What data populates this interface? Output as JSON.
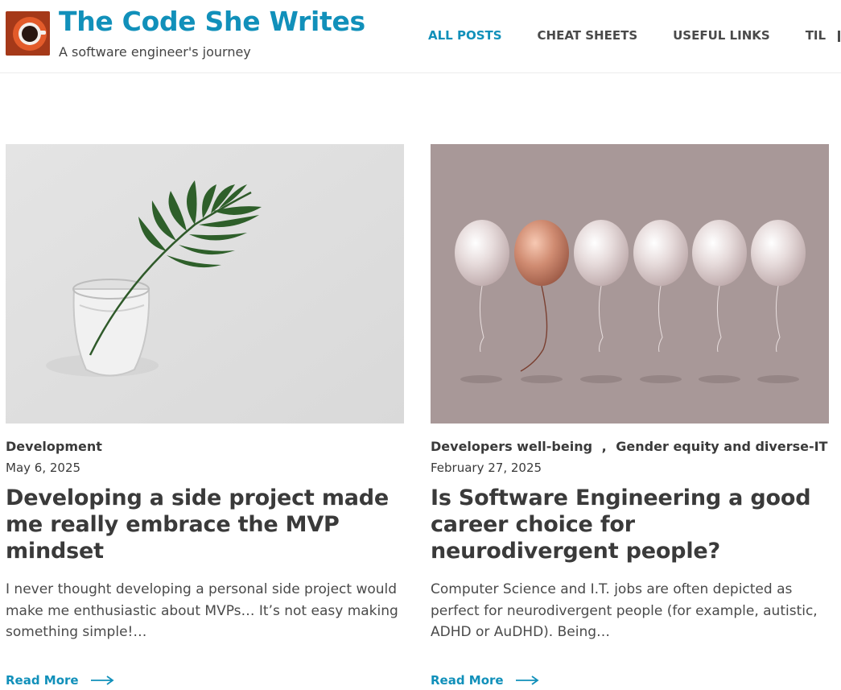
{
  "site": {
    "title": "The Code She Writes",
    "tagline": "A software engineer's journey"
  },
  "nav": {
    "items": [
      {
        "label": "ALL POSTS",
        "active": true
      },
      {
        "label": "CHEAT SHEETS",
        "active": false
      },
      {
        "label": "USEFUL LINKS",
        "active": false
      },
      {
        "label": "TIL",
        "active": false
      }
    ]
  },
  "posts": [
    {
      "categories": [
        "Development"
      ],
      "date": "May 6, 2025",
      "title": "Developing a side project made me really embrace the MVP mindset",
      "excerpt": "I never thought developing a personal side project would make me enthusiastic about MVPs… It’s not easy making something simple!…",
      "read_more": "Read More",
      "image": "palm-leaf-in-glass"
    },
    {
      "categories": [
        "Developers well-being",
        "Gender equity and diverse-IT"
      ],
      "category_separator": ",",
      "date": "February 27, 2025",
      "title": "Is Software Engineering a good career choice for neurodivergent people?",
      "excerpt": "Computer Science and I.T. jobs are often depicted as perfect for neurodivergent people (for example, autistic, ADHD or AuDHD). Being…",
      "read_more": "Read More",
      "image": "balloons-one-different"
    }
  ],
  "colors": {
    "accent": "#1190ba",
    "text": "#3a3a3a",
    "balloon_bg": "#a89898",
    "copper_balloon": "#c98b73"
  }
}
